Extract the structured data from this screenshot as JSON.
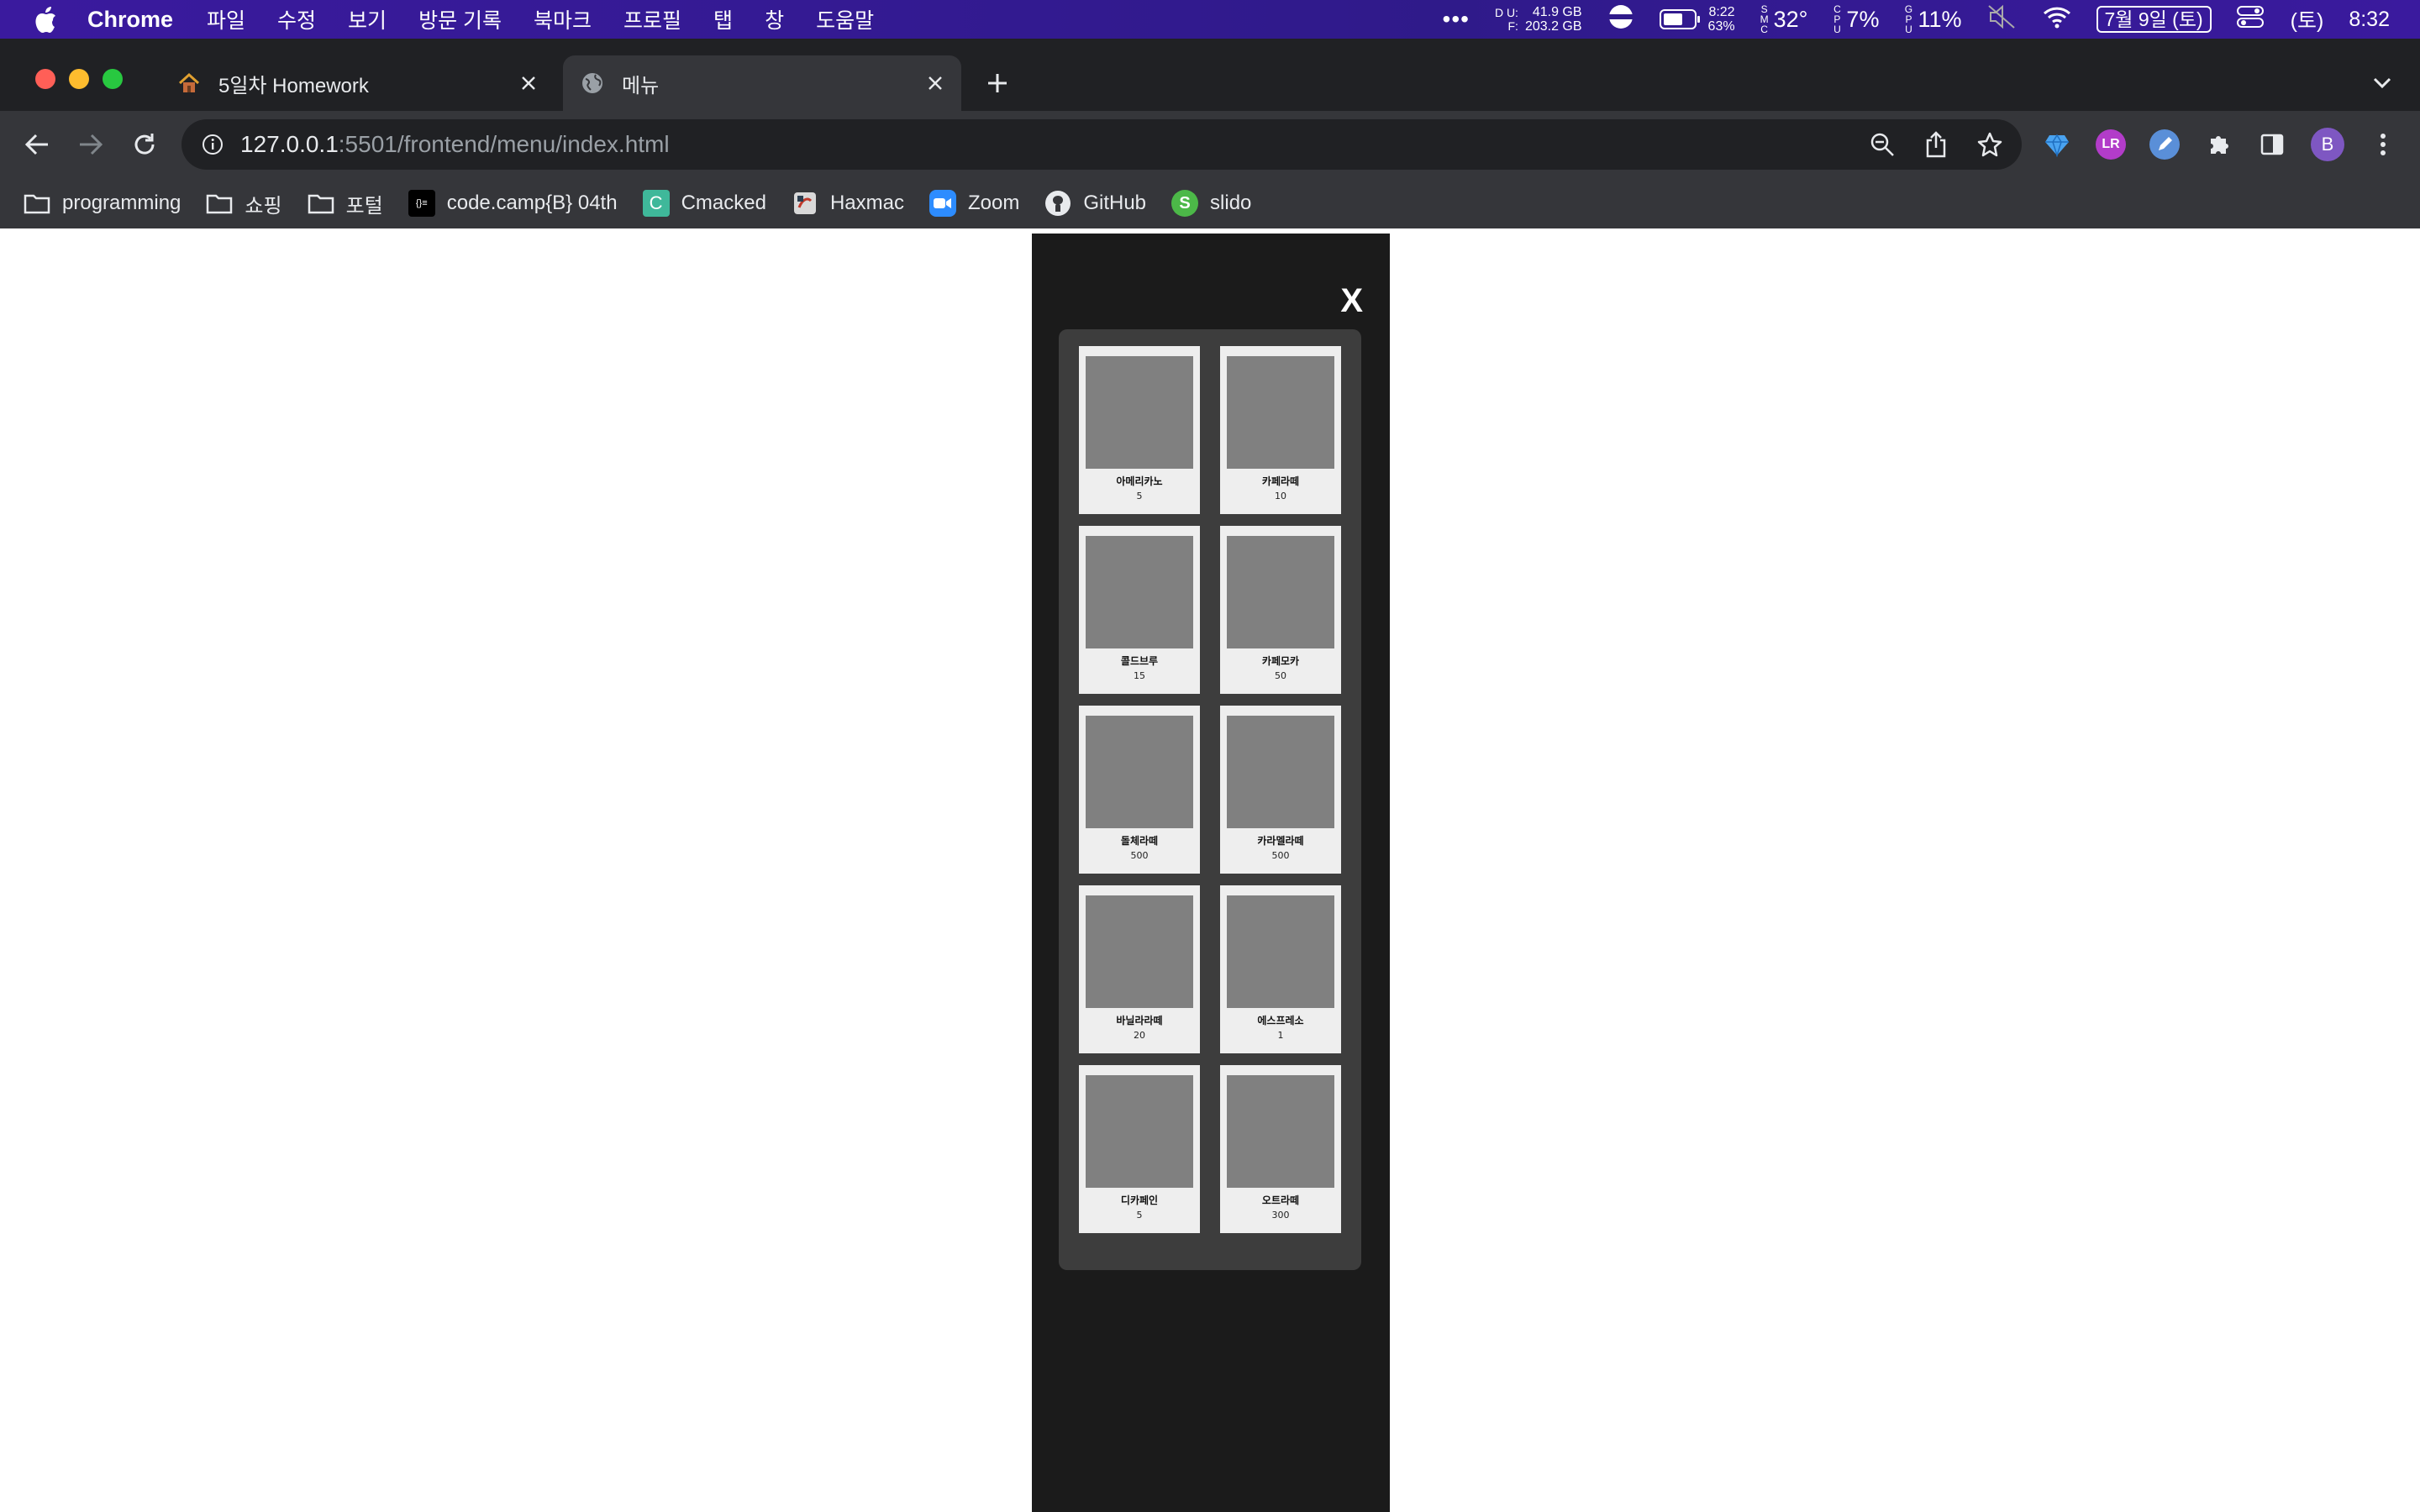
{
  "menubar": {
    "app_name": "Chrome",
    "menus": [
      "파일",
      "수정",
      "보기",
      "방문 기록",
      "북마크",
      "프로필",
      "탭",
      "창",
      "도움말"
    ],
    "disk_used": "41.9 GB",
    "disk_free": "203.2 GB",
    "disk_used_label": "D U:",
    "disk_free_label": "F:",
    "battery_time": "8:22",
    "battery_percent": "63%",
    "temp": "32°",
    "cpu": "7%",
    "gpu": "11%",
    "date": "7월 9일 (토)",
    "day": "(토)",
    "time": "8:32"
  },
  "tabs": [
    {
      "title": "5일차 Homework",
      "active": false
    },
    {
      "title": "메뉴",
      "active": true
    }
  ],
  "address": {
    "host": "127.0.0.1",
    "path": ":5501/frontend/menu/index.html"
  },
  "profile_initial": "B",
  "bookmarks": [
    {
      "label": "programming",
      "icon": "folder-icon"
    },
    {
      "label": "쇼핑",
      "icon": "folder-icon"
    },
    {
      "label": "포털",
      "icon": "folder-icon"
    },
    {
      "label": "code.camp{B} 04th",
      "icon": "codecamp-icon"
    },
    {
      "label": "Cmacked",
      "icon": "cmacked-icon"
    },
    {
      "label": "Haxmac",
      "icon": "haxmac-icon"
    },
    {
      "label": "Zoom",
      "icon": "zoom-icon"
    },
    {
      "label": "GitHub",
      "icon": "github-icon"
    },
    {
      "label": "slido",
      "icon": "slido-icon"
    }
  ],
  "page": {
    "close_label": "X",
    "items": [
      {
        "name": "아메리카노",
        "price": "5"
      },
      {
        "name": "카페라떼",
        "price": "10"
      },
      {
        "name": "콜드브루",
        "price": "15"
      },
      {
        "name": "카페모카",
        "price": "50"
      },
      {
        "name": "돌체라떼",
        "price": "500"
      },
      {
        "name": "카라멜라떼",
        "price": "500"
      },
      {
        "name": "바닐라라떼",
        "price": "20"
      },
      {
        "name": "에스프레소",
        "price": "1"
      },
      {
        "name": "디카페인",
        "price": "5"
      },
      {
        "name": "오트라떼",
        "price": "300"
      }
    ]
  }
}
